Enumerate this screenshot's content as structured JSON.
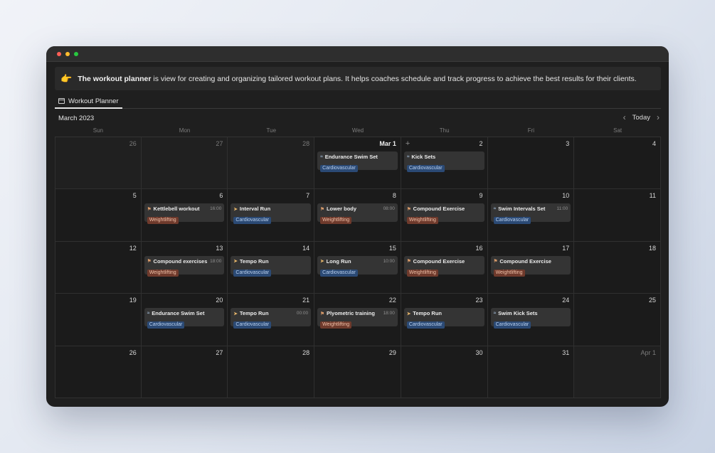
{
  "window": {
    "traffic_lights": [
      "close",
      "minimize",
      "zoom"
    ]
  },
  "callout": {
    "emoji": "👉",
    "bold": "The workout planner",
    "text": " is view for creating and organizing tailored workout plans. It helps coaches schedule and track progress to achieve the best results for their clients."
  },
  "tab": {
    "label": "Workout Planner",
    "icon": "calendar-icon"
  },
  "month": "March 2023",
  "nav": {
    "today": "Today",
    "prev_icon": "chevron-left-icon",
    "next_icon": "chevron-right-icon"
  },
  "weekdays": [
    "Sun",
    "Mon",
    "Tue",
    "Wed",
    "Thu",
    "Fri",
    "Sat"
  ],
  "tag_colors": {
    "Cardiovascular": "#2b4a75",
    "Weightlifting": "#6f3a2c"
  },
  "weeks": [
    [
      {
        "day": "26",
        "muted": true
      },
      {
        "day": "27",
        "muted": true
      },
      {
        "day": "28",
        "muted": true
      },
      {
        "day": "Mar 1",
        "bold": true,
        "event": {
          "icon": "swim",
          "title": "Endurance Swim Set",
          "time": "",
          "tag": "Cardiovascular"
        }
      },
      {
        "day": "2",
        "plus": true,
        "event": {
          "icon": "swim",
          "title": "Kick Sets",
          "time": "",
          "tag": "Cardiovascular"
        }
      },
      {
        "day": "3"
      },
      {
        "day": "4"
      }
    ],
    [
      {
        "day": "5"
      },
      {
        "day": "6",
        "event": {
          "icon": "weights",
          "title": "Kettlebell workout",
          "time": "16:00",
          "tag": "Weightlifting"
        }
      },
      {
        "day": "7",
        "event": {
          "icon": "run",
          "title": "Interval Run",
          "time": "",
          "tag": "Cardiovascular"
        }
      },
      {
        "day": "8",
        "event": {
          "icon": "weights",
          "title": "Lower body",
          "time": "08:00",
          "tag": "Weightlifting"
        }
      },
      {
        "day": "9",
        "event": {
          "icon": "weights",
          "title": "Compound Exercise",
          "time": "",
          "tag": "Weightlifting"
        }
      },
      {
        "day": "10",
        "event": {
          "icon": "swim",
          "title": "Swim Intervals Set",
          "time": "11:00",
          "tag": "Cardiovascular"
        }
      },
      {
        "day": "11"
      }
    ],
    [
      {
        "day": "12"
      },
      {
        "day": "13",
        "event": {
          "icon": "weights",
          "title": "Compound exercises",
          "time": "18:00",
          "tag": "Weightlifting"
        }
      },
      {
        "day": "14",
        "event": {
          "icon": "run",
          "title": "Tempo Run",
          "time": "",
          "tag": "Cardiovascular"
        }
      },
      {
        "day": "15",
        "event": {
          "icon": "run",
          "title": "Long Run",
          "time": "10:00",
          "tag": "Cardiovascular"
        }
      },
      {
        "day": "16",
        "event": {
          "icon": "weights",
          "title": "Compound Exercise",
          "time": "",
          "tag": "Weightlifting"
        }
      },
      {
        "day": "17",
        "event": {
          "icon": "weights",
          "title": "Compound Exercise",
          "time": "",
          "tag": "Weightlifting"
        }
      },
      {
        "day": "18"
      }
    ],
    [
      {
        "day": "19"
      },
      {
        "day": "20",
        "event": {
          "icon": "swim",
          "title": "Endurance Swim Set",
          "time": "",
          "tag": "Cardiovascular"
        }
      },
      {
        "day": "21",
        "event": {
          "icon": "run",
          "title": "Tempo Run",
          "time": "00:00",
          "tag": "Cardiovascular"
        }
      },
      {
        "day": "22",
        "event": {
          "icon": "weights",
          "title": "Plyometric training",
          "time": "18:00",
          "tag": "Weightlifting"
        }
      },
      {
        "day": "23",
        "event": {
          "icon": "run",
          "title": "Tempo Run",
          "time": "",
          "tag": "Cardiovascular"
        }
      },
      {
        "day": "24",
        "event": {
          "icon": "swim",
          "title": "Swim Kick Sets",
          "time": "",
          "tag": "Cardiovascular"
        }
      },
      {
        "day": "25"
      }
    ],
    [
      {
        "day": "26"
      },
      {
        "day": "27"
      },
      {
        "day": "28"
      },
      {
        "day": "29"
      },
      {
        "day": "30"
      },
      {
        "day": "31"
      },
      {
        "day": "Apr 1",
        "muted": true
      }
    ]
  ]
}
